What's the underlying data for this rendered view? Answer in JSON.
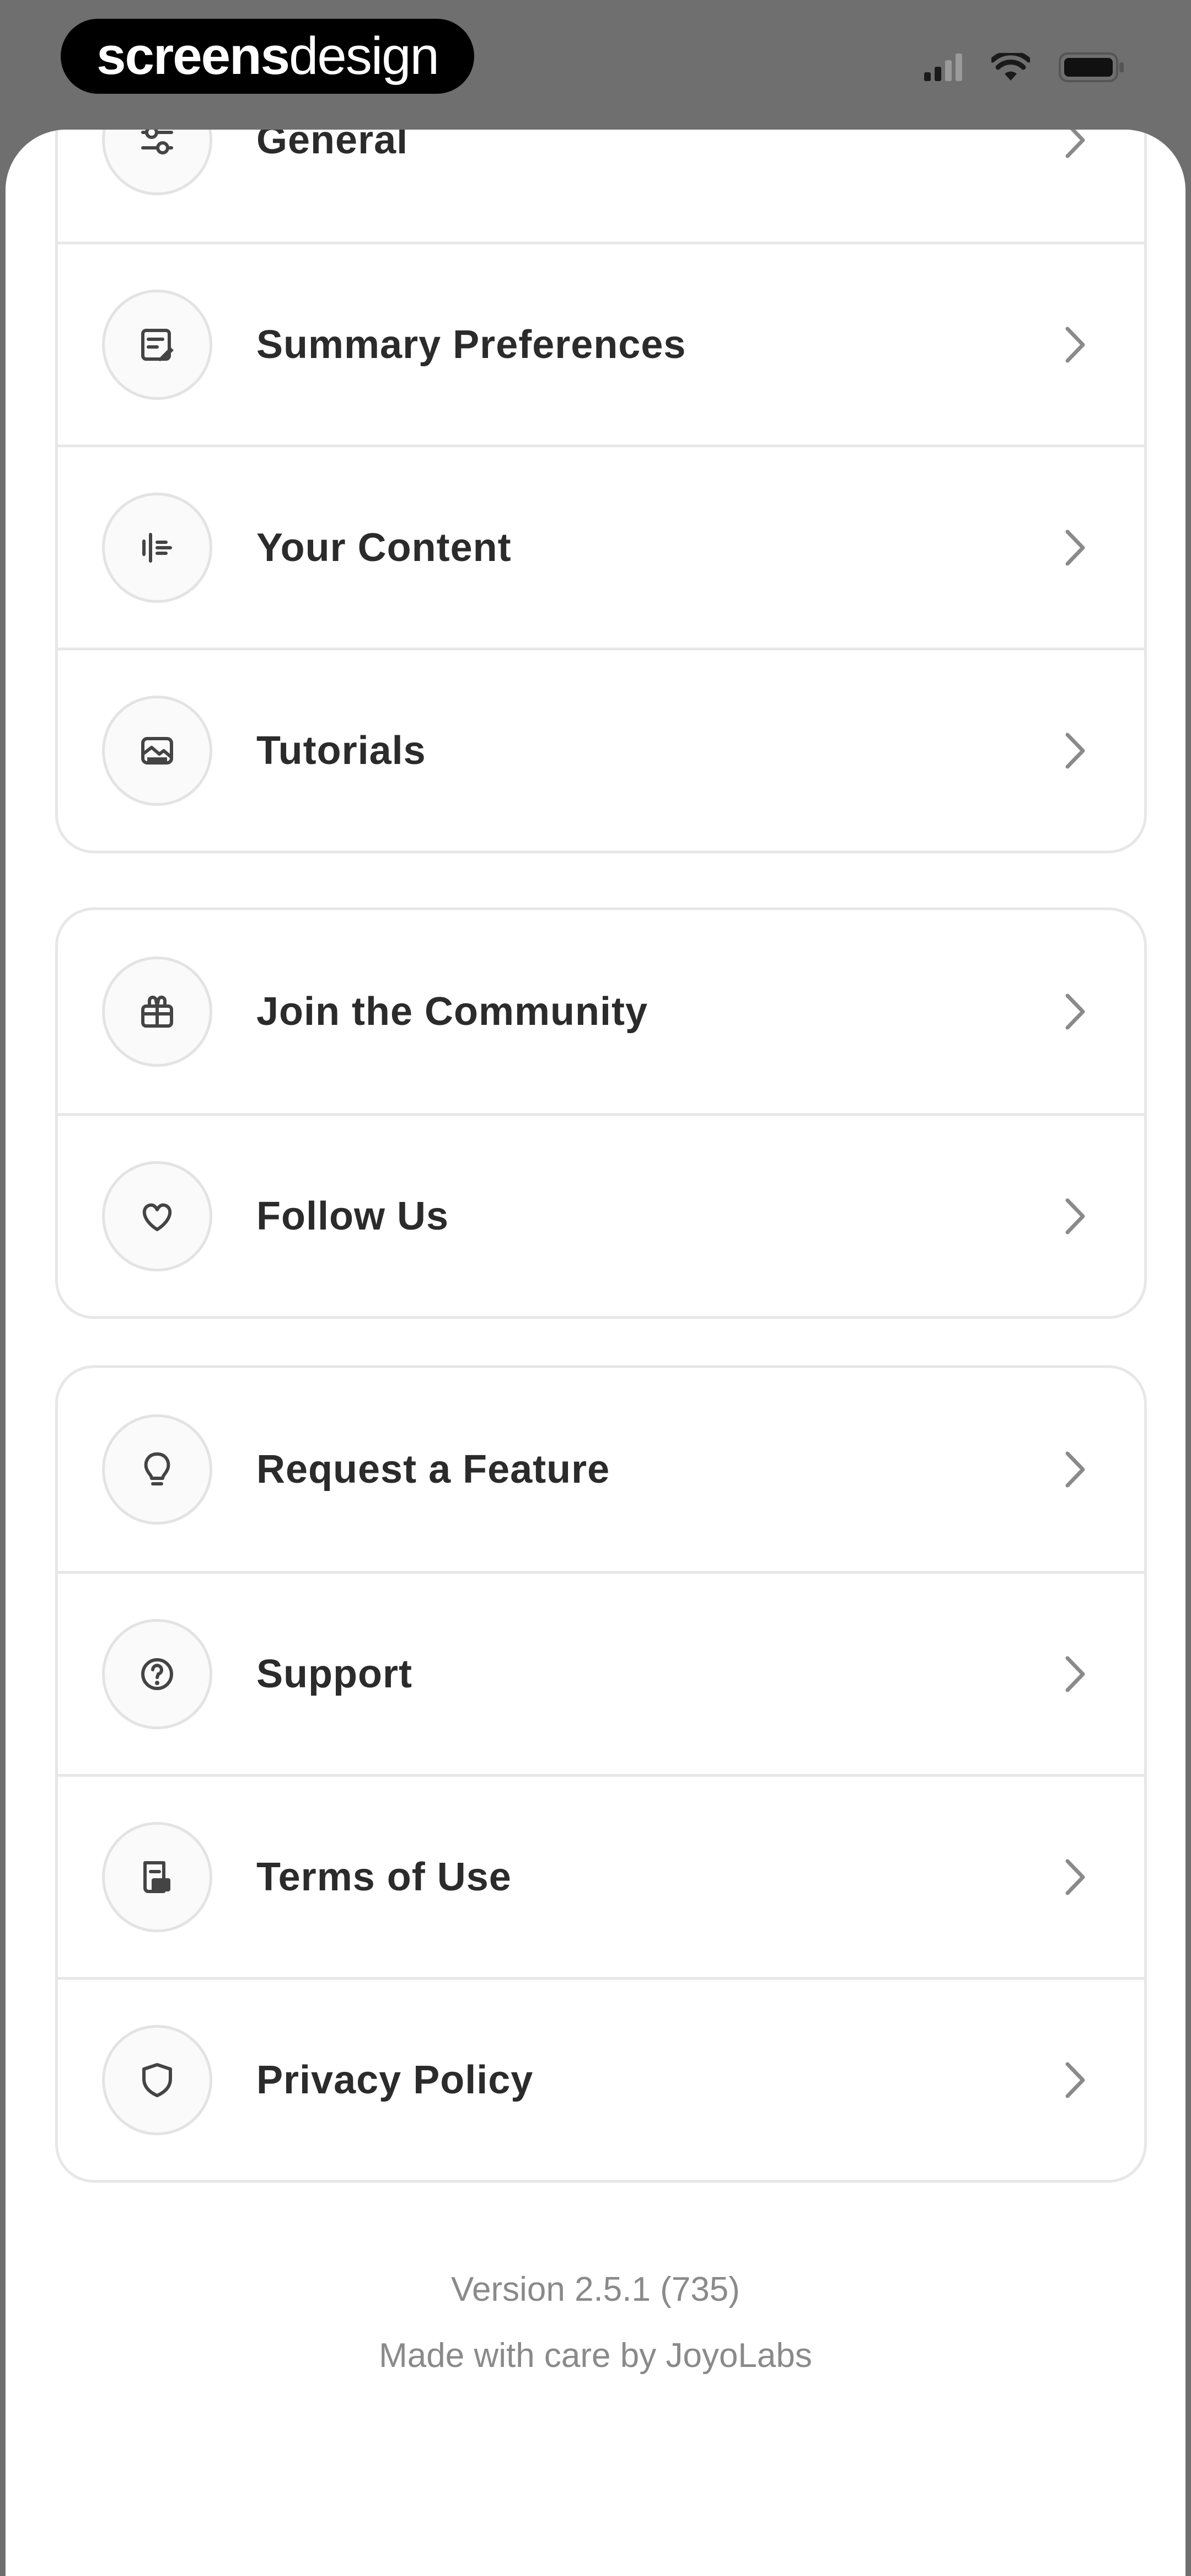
{
  "status_bar": {
    "brand_bold": "screens",
    "brand_light": "design"
  },
  "sections": [
    {
      "items": [
        {
          "label": "General",
          "icon": "sliders-icon"
        },
        {
          "label": "Summary Preferences",
          "icon": "note-edit-icon"
        },
        {
          "label": "Your Content",
          "icon": "content-icon"
        },
        {
          "label": "Tutorials",
          "icon": "tutorial-icon"
        }
      ]
    },
    {
      "items": [
        {
          "label": "Join the Community",
          "icon": "community-icon"
        },
        {
          "label": "Follow Us",
          "icon": "heart-icon"
        }
      ]
    },
    {
      "items": [
        {
          "label": "Request a Feature",
          "icon": "lightbulb-icon"
        },
        {
          "label": "Support",
          "icon": "help-circle-icon"
        },
        {
          "label": "Terms of Use",
          "icon": "document-icon"
        },
        {
          "label": "Privacy Policy",
          "icon": "shield-icon"
        }
      ]
    }
  ],
  "footer": {
    "version": "Version 2.5.1 (735)",
    "made_by": "Made with care by JoyoLabs"
  },
  "colors": {
    "status_bar_bg": "#6f6f6f",
    "sheet_bg": "#ffffff",
    "card_border": "#e7e7e7",
    "label_text": "#2b2b2b",
    "footer_text": "#8a8a8a"
  }
}
